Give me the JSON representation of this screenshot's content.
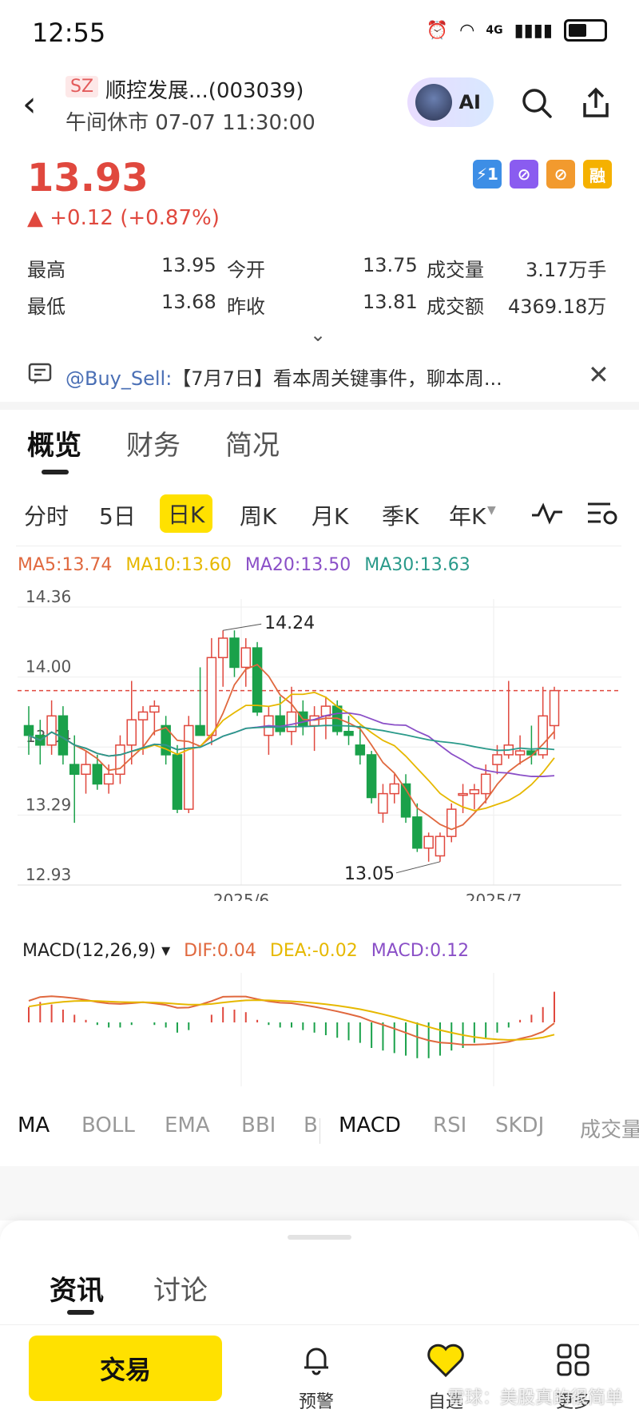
{
  "status_bar": {
    "time": "12:55",
    "network": "4G"
  },
  "header": {
    "market_tag": "SZ",
    "stock_name": "顺控发展...(003039)",
    "status": "午间休市 07-07 11:30:00",
    "ai_label": "AI"
  },
  "quote": {
    "price": "13.93",
    "change": "▲ +0.12 (+0.87%)",
    "badges": [
      "⚡1",
      "⊘",
      "⊘",
      "融"
    ],
    "stats": [
      {
        "label": "最高",
        "value": "13.95",
        "label2": "今开",
        "value2": "13.75",
        "label3": "成交量",
        "value3": "3.17万手"
      },
      {
        "label": "最低",
        "value": "13.68",
        "label2": "昨收",
        "value2": "13.81",
        "label3": "成交额",
        "value3": "4369.18万"
      }
    ]
  },
  "notice": {
    "user": "@Buy_Sell:",
    "text": "【7月7日】看本周关键事件，聊本周..."
  },
  "tabs": [
    "概览",
    "财务",
    "简况"
  ],
  "periods": [
    "分时",
    "5日",
    "日K",
    "周K",
    "月K",
    "季K",
    "年K"
  ],
  "ma_legend": {
    "ma5": "MA5:13.74",
    "ma10": "MA10:13.60",
    "ma20": "MA20:13.50",
    "ma30": "MA30:13.63"
  },
  "macd_legend": {
    "title": "MACD(12,26,9) ▾",
    "dif": "DIF:0.04",
    "dea": "DEA:-0.02",
    "macd": "MACD:0.12"
  },
  "indicator_tabs": [
    "MA",
    "BOLL",
    "EMA",
    "BBI",
    "B",
    "MACD",
    "RSI",
    "SKDJ",
    "成交量"
  ],
  "news_tabs": [
    "资讯",
    "讨论"
  ],
  "bottom_bar": {
    "trade": "交易",
    "alert": "预警",
    "watch": "自选",
    "more": "更多"
  },
  "watermark": "雪球：美股真的很简单",
  "colors": {
    "up": "#e0483e",
    "down": "#1aa14a",
    "accent": "#ffe100",
    "ma5": "#e0683e",
    "ma10": "#e6b800",
    "ma20": "#8a4fc7",
    "ma30": "#2a9a8a"
  },
  "chart_data": [
    {
      "type": "candlestick",
      "ylim": [
        12.93,
        14.36
      ],
      "y_ticks": [
        "14.36",
        "14.00",
        "13.64",
        "13.29",
        "12.93"
      ],
      "x_labels": [
        "2025/6",
        "2025/7"
      ],
      "annotations": [
        "14.24",
        "13.05"
      ],
      "ohlc": [
        [
          13.75,
          13.85,
          13.6,
          13.7
        ],
        [
          13.7,
          13.78,
          13.55,
          13.65
        ],
        [
          13.65,
          13.88,
          13.6,
          13.8
        ],
        [
          13.8,
          13.85,
          13.55,
          13.6
        ],
        [
          13.55,
          13.7,
          13.25,
          13.5
        ],
        [
          13.5,
          13.62,
          13.4,
          13.55
        ],
        [
          13.55,
          13.6,
          13.42,
          13.45
        ],
        [
          13.45,
          13.55,
          13.4,
          13.5
        ],
        [
          13.5,
          13.7,
          13.45,
          13.65
        ],
        [
          13.65,
          13.98,
          13.55,
          13.78
        ],
        [
          13.78,
          13.85,
          13.6,
          13.82
        ],
        [
          13.82,
          13.88,
          13.7,
          13.85
        ],
        [
          13.75,
          13.8,
          13.55,
          13.6
        ],
        [
          13.6,
          13.65,
          13.3,
          13.32
        ],
        [
          13.32,
          13.8,
          13.3,
          13.75
        ],
        [
          13.75,
          14.05,
          13.7,
          13.7
        ],
        [
          13.7,
          14.2,
          13.65,
          14.1
        ],
        [
          14.1,
          14.24,
          13.95,
          14.2
        ],
        [
          14.2,
          14.24,
          14.0,
          14.05
        ],
        [
          14.05,
          14.2,
          13.95,
          14.15
        ],
        [
          14.15,
          14.18,
          13.8,
          13.82
        ],
        [
          13.7,
          13.85,
          13.6,
          13.8
        ],
        [
          13.8,
          13.9,
          13.7,
          13.72
        ],
        [
          13.72,
          13.95,
          13.65,
          13.82
        ],
        [
          13.82,
          13.88,
          13.7,
          13.75
        ],
        [
          13.75,
          13.85,
          13.62,
          13.8
        ],
        [
          13.8,
          13.9,
          13.68,
          13.85
        ],
        [
          13.85,
          13.88,
          13.7,
          13.72
        ],
        [
          13.72,
          13.8,
          13.65,
          13.7
        ],
        [
          13.65,
          13.75,
          13.55,
          13.6
        ],
        [
          13.6,
          13.62,
          13.35,
          13.38
        ],
        [
          13.3,
          13.45,
          13.25,
          13.4
        ],
        [
          13.4,
          13.5,
          13.35,
          13.45
        ],
        [
          13.45,
          13.5,
          13.25,
          13.28
        ],
        [
          13.28,
          13.35,
          13.1,
          13.12
        ],
        [
          13.12,
          13.2,
          13.05,
          13.18
        ],
        [
          13.08,
          13.2,
          13.05,
          13.18
        ],
        [
          13.18,
          13.35,
          13.15,
          13.32
        ],
        [
          13.4,
          13.45,
          13.3,
          13.4
        ],
        [
          13.4,
          13.45,
          13.32,
          13.42
        ],
        [
          13.4,
          13.55,
          13.35,
          13.5
        ],
        [
          13.55,
          13.65,
          13.5,
          13.6
        ],
        [
          13.6,
          13.98,
          13.58,
          13.65
        ],
        [
          13.6,
          13.7,
          13.55,
          13.62
        ],
        [
          13.62,
          13.75,
          13.55,
          13.6
        ],
        [
          13.6,
          13.95,
          13.58,
          13.8
        ],
        [
          13.75,
          13.95,
          13.68,
          13.93
        ]
      ]
    },
    {
      "type": "bar",
      "name": "MACD",
      "values": [
        0.06,
        0.08,
        0.07,
        0.05,
        0.03,
        0.01,
        -0.01,
        -0.02,
        -0.02,
        -0.01,
        0.0,
        -0.01,
        -0.02,
        -0.04,
        -0.03,
        0.0,
        0.03,
        0.06,
        0.05,
        0.04,
        0.01,
        -0.01,
        -0.02,
        -0.02,
        -0.03,
        -0.04,
        -0.05,
        -0.06,
        -0.07,
        -0.08,
        -0.1,
        -0.11,
        -0.12,
        -0.13,
        -0.14,
        -0.14,
        -0.13,
        -0.11,
        -0.1,
        -0.08,
        -0.06,
        -0.04,
        -0.02,
        0.01,
        0.03,
        0.06,
        0.12
      ]
    }
  ]
}
